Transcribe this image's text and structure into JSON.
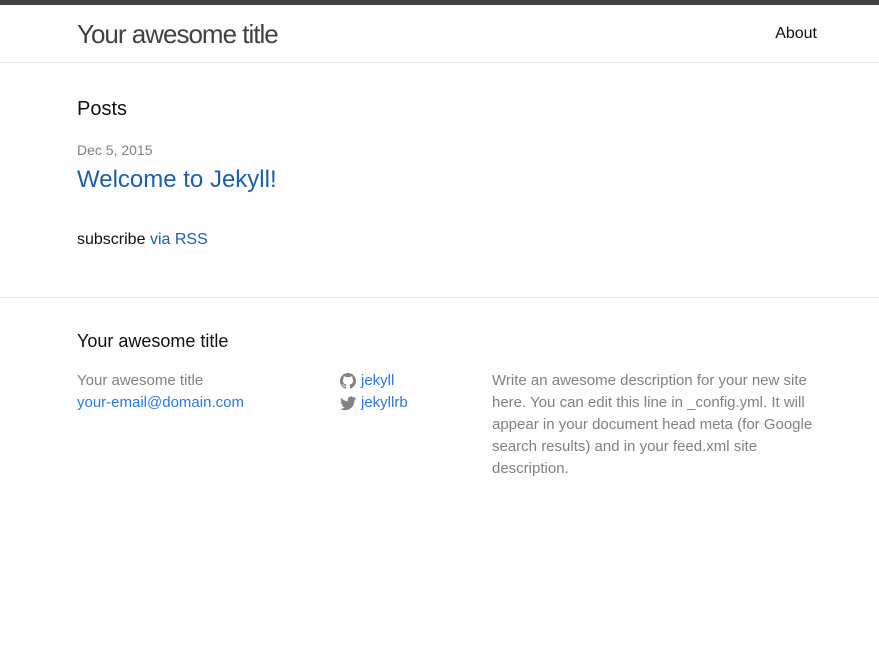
{
  "header": {
    "site_title": "Your awesome title",
    "nav": [
      {
        "label": "About"
      }
    ]
  },
  "main": {
    "heading": "Posts",
    "posts": [
      {
        "date": "Dec 5, 2015",
        "title": "Welcome to Jekyll!"
      }
    ],
    "rss_prefix": "subscribe",
    "rss_link": "via RSS"
  },
  "footer": {
    "heading": "Your awesome title",
    "name": "Your awesome title",
    "email": "your-email@domain.com",
    "github_username": "jekyll",
    "twitter_username": "jekyllrb",
    "description": "Write an awesome description for your new site here. You can edit this line in _config.yml. It will appear in your document head meta (for Google search results) and in your feed.xml site description."
  },
  "icons": {
    "github": "github-icon",
    "twitter": "twitter-icon"
  },
  "colors": {
    "link": "#2a7ae2",
    "post_link": "#1f5fa8",
    "meta": "#828282",
    "topbar": "#424242"
  }
}
